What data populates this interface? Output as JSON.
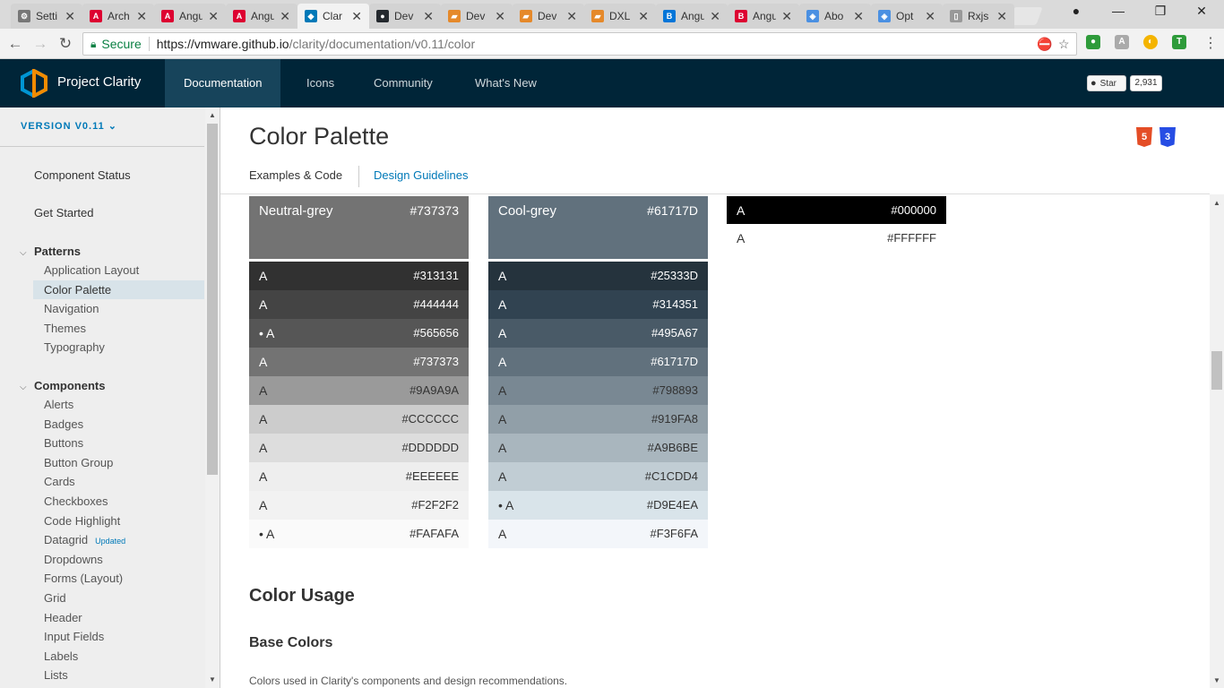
{
  "browser": {
    "tabs": [
      {
        "title": "Setti",
        "icon": "gear-icon",
        "color": "#777777",
        "glyph": "⚙"
      },
      {
        "title": "Arch",
        "icon": "angular-icon",
        "color": "#dd0031",
        "glyph": "A"
      },
      {
        "title": "Angu",
        "icon": "angular-icon",
        "color": "#dd0031",
        "glyph": "A"
      },
      {
        "title": "Angu",
        "icon": "angular-icon",
        "color": "#dd0031",
        "glyph": "A"
      },
      {
        "title": "Clar",
        "icon": "clarity-icon",
        "color": "#0079b8",
        "glyph": "◆"
      },
      {
        "title": "Dev",
        "icon": "github-icon",
        "color": "#24292e",
        "glyph": "●"
      },
      {
        "title": "Dev",
        "icon": "folder-icon",
        "color": "#e5892a",
        "glyph": "▰"
      },
      {
        "title": "Dev",
        "icon": "folder-icon",
        "color": "#e5892a",
        "glyph": "▰"
      },
      {
        "title": "DXL",
        "icon": "folder-icon",
        "color": "#e5892a",
        "glyph": "▰"
      },
      {
        "title": "Angu",
        "icon": "bootstrap-icon",
        "color": "#0275d8",
        "glyph": "B"
      },
      {
        "title": "Angu",
        "icon": "bootstrap-icon",
        "color": "#dd0031",
        "glyph": "B"
      },
      {
        "title": "Abo",
        "icon": "layers-icon",
        "color": "#4a90e2",
        "glyph": "◈"
      },
      {
        "title": "Opt",
        "icon": "layers-icon",
        "color": "#4a90e2",
        "glyph": "◈"
      },
      {
        "title": "Rxjs",
        "icon": "document-icon",
        "color": "#999999",
        "glyph": "▯"
      }
    ],
    "active_tab": 4,
    "close_glyph": "✕",
    "secure_label": "Secure",
    "url_host": "https://vmware.github.io",
    "url_path": "/clarity/documentation/v0.11/color"
  },
  "header": {
    "brand": "Project Clarity",
    "nav": [
      "Documentation",
      "Icons",
      "Community",
      "What's New"
    ],
    "star_label": "Star",
    "star_count": "2,931"
  },
  "sidebar": {
    "version": "VERSION V0.11",
    "top_links": [
      "Component Status",
      "Get Started"
    ],
    "patterns_label": "Patterns",
    "patterns": [
      "Application Layout",
      "Color Palette",
      "Navigation",
      "Themes",
      "Typography"
    ],
    "components_label": "Components",
    "components": [
      "Alerts",
      "Badges",
      "Buttons",
      "Button Group",
      "Cards",
      "Checkboxes",
      "Code Highlight",
      "Datagrid",
      "Dropdowns",
      "Forms (Layout)",
      "Grid",
      "Header",
      "Input Fields",
      "Labels",
      "Lists"
    ],
    "updated_badge": "Updated"
  },
  "content": {
    "title": "Color Palette",
    "tabs": [
      "Examples & Code",
      "Design Guidelines"
    ],
    "html5_label": "5",
    "css3_label": "3",
    "palettes": [
      {
        "name": "Neutral-grey",
        "hex": "#737373",
        "swatches": [
          {
            "letter": "A",
            "hex": "#313131",
            "fg": "#ffffff",
            "bullet": false
          },
          {
            "letter": "A",
            "hex": "#444444",
            "fg": "#ffffff",
            "bullet": false
          },
          {
            "letter": "A",
            "hex": "#565656",
            "fg": "#ffffff",
            "bullet": true
          },
          {
            "letter": "A",
            "hex": "#737373",
            "fg": "#ffffff",
            "bullet": false
          },
          {
            "letter": "A",
            "hex": "#9A9A9A",
            "fg": "#333333",
            "bullet": false
          },
          {
            "letter": "A",
            "hex": "#CCCCCC",
            "fg": "#333333",
            "bullet": false
          },
          {
            "letter": "A",
            "hex": "#DDDDDD",
            "fg": "#333333",
            "bullet": false
          },
          {
            "letter": "A",
            "hex": "#EEEEEE",
            "fg": "#333333",
            "bullet": false
          },
          {
            "letter": "A",
            "hex": "#F2F2F2",
            "fg": "#333333",
            "bullet": false
          },
          {
            "letter": "A",
            "hex": "#FAFAFA",
            "fg": "#333333",
            "bullet": true
          }
        ]
      },
      {
        "name": "Cool-grey",
        "hex": "#61717D",
        "swatches": [
          {
            "letter": "A",
            "hex": "#25333D",
            "fg": "#ffffff",
            "bullet": false
          },
          {
            "letter": "A",
            "hex": "#314351",
            "fg": "#ffffff",
            "bullet": false
          },
          {
            "letter": "A",
            "hex": "#495A67",
            "fg": "#ffffff",
            "bullet": false
          },
          {
            "letter": "A",
            "hex": "#61717D",
            "fg": "#ffffff",
            "bullet": false
          },
          {
            "letter": "A",
            "hex": "#798893",
            "fg": "#333333",
            "bullet": false
          },
          {
            "letter": "A",
            "hex": "#919FA8",
            "fg": "#333333",
            "bullet": false
          },
          {
            "letter": "A",
            "hex": "#A9B6BE",
            "fg": "#333333",
            "bullet": false
          },
          {
            "letter": "A",
            "hex": "#C1CDD4",
            "fg": "#333333",
            "bullet": false
          },
          {
            "letter": "A",
            "hex": "#D9E4EA",
            "fg": "#333333",
            "bullet": true
          },
          {
            "letter": "A",
            "hex": "#F3F6FA",
            "fg": "#333333",
            "bullet": false
          }
        ]
      },
      {
        "name": "",
        "hex": "",
        "swatches": [
          {
            "letter": "A",
            "hex": "#000000",
            "fg": "#ffffff",
            "bullet": false
          },
          {
            "letter": "A",
            "hex": "#FFFFFF",
            "fg": "#333333",
            "bullet": false
          }
        ]
      }
    ],
    "color_usage": "Color Usage",
    "base_colors": "Base Colors",
    "base_colors_desc": "Colors used in Clarity's components and design recommendations."
  },
  "colors": {
    "header_bg": "#002538",
    "active_nav_bg": "#17445b",
    "link_blue": "#0079b8",
    "sidebar_bg": "#eeeeee",
    "sidebar_active": "#d8e3e9"
  }
}
